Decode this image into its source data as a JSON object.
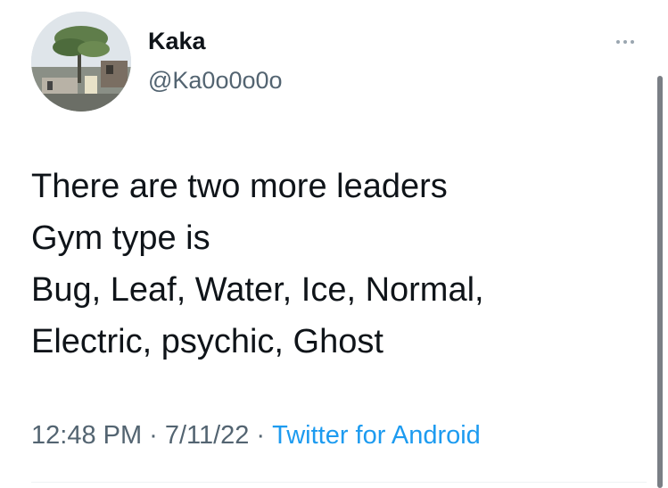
{
  "user": {
    "display_name": "Kaka",
    "handle": "@Ka0o0o0o"
  },
  "tweet": {
    "lines": [
      "There are two more leaders",
      "Gym type is",
      "Bug, Leaf, Water, Ice, Normal,",
      "Electric, psychic, Ghost"
    ]
  },
  "meta": {
    "time": "12:48 PM",
    "separator": "·",
    "date": "7/11/22",
    "source": "Twitter for Android"
  },
  "icons": {
    "more": "more-horizontal-icon"
  },
  "colors": {
    "text": "#0f1419",
    "secondary": "#536471",
    "link": "#1d9bf0"
  }
}
